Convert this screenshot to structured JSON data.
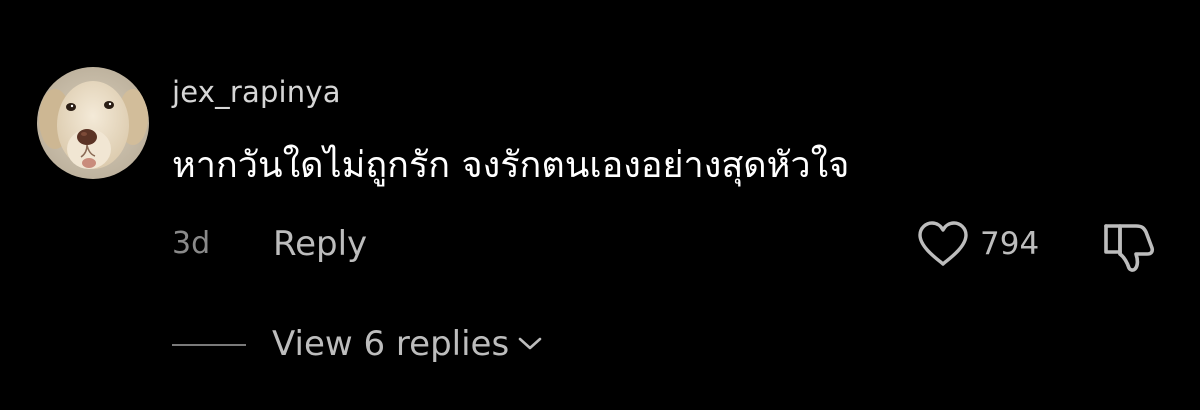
{
  "comment": {
    "username": "jex_rapinya",
    "text": "หากวันใดไม่ถูกรัก จงรักตนเองอย่างสุดหัวใจ",
    "timestamp": "3d",
    "reply_label": "Reply",
    "like_count": "794",
    "view_replies_label": "View 6 replies"
  },
  "icons": {
    "avatar": "dog-avatar",
    "like": "heart-icon",
    "dislike": "thumbs-down-icon",
    "expand": "chevron-down-icon"
  },
  "colors": {
    "background": "#000000",
    "primary_text": "#ffffff",
    "secondary_text": "#bdbdbd",
    "muted_text": "#8a8a8a"
  }
}
